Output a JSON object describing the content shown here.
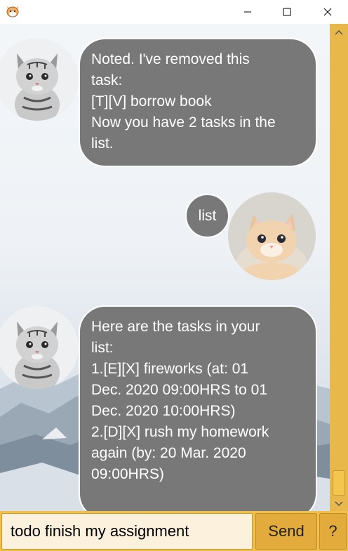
{
  "window": {
    "app_icon": "cat-face-icon",
    "controls": {
      "minimize": "minimize-icon",
      "maximize": "maximize-icon",
      "close": "close-icon"
    }
  },
  "messages": [
    {
      "sender": "bot",
      "avatar": "tabby-kitten-avatar",
      "lines": [
        "Noted. I've removed this",
        "task:",
        "[T][V] borrow book",
        "Now you have 2 tasks in the",
        "list."
      ]
    },
    {
      "sender": "user",
      "avatar": "orange-kitten-avatar",
      "text": "list"
    },
    {
      "sender": "bot",
      "avatar": "tabby-kitten-avatar",
      "lines": [
        "Here are the tasks in your",
        "list:",
        "1.[E][X] fireworks (at: 01",
        "Dec. 2020 09:00HRS to 01",
        "Dec. 2020 10:00HRS)",
        "2.[D][X] rush my homework",
        "again (by: 20 Mar. 2020",
        "09:00HRS)"
      ]
    }
  ],
  "input": {
    "value": "todo finish my assignment",
    "send_label": "Send",
    "help_label": "?"
  },
  "colors": {
    "bubble": "#787878",
    "accent": "#f0c04a",
    "scrollbar": "#e8b84a"
  }
}
